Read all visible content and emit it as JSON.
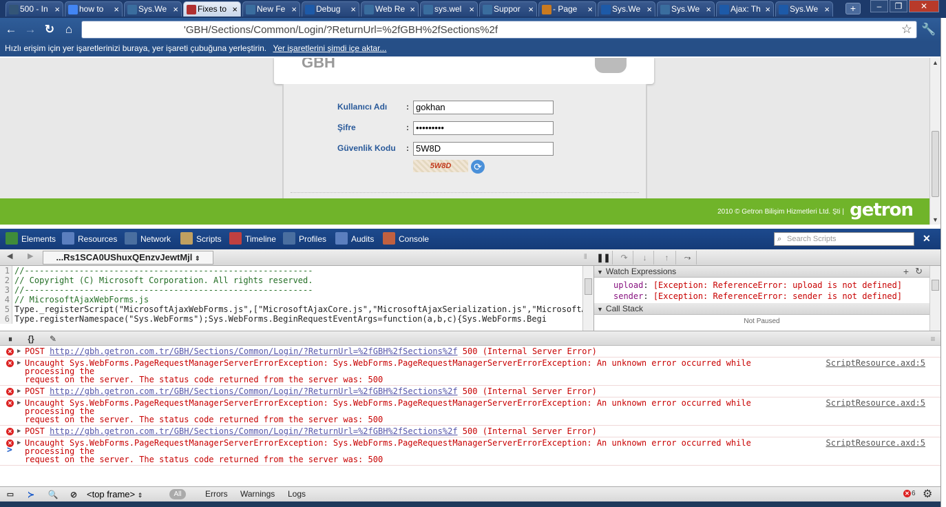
{
  "tabs": [
    {
      "title": "500 - In",
      "icon_color": "#335577",
      "icon": "chrome",
      "active": false
    },
    {
      "title": "how to",
      "icon_color": "#4285f4",
      "icon": "google",
      "active": false
    },
    {
      "title": "Sys.We",
      "icon_color": "#3a6d9e",
      "icon": "stackoverflow",
      "active": false
    },
    {
      "title": "Fixes to",
      "icon_color": "#b03030",
      "icon": "page",
      "active": true
    },
    {
      "title": "New Fe",
      "icon_color": "#3a6d9e",
      "icon": "stackoverflow",
      "active": false
    },
    {
      "title": "Debug",
      "icon_color": "#1d5aa8",
      "icon": "asp-net",
      "active": false
    },
    {
      "title": "Web Re",
      "icon_color": "#3a6d9e",
      "icon": "stackoverflow",
      "active": false
    },
    {
      "title": "sys.wel",
      "icon_color": "#3a6d9e",
      "icon": "stackoverflow",
      "active": false
    },
    {
      "title": "Suppor",
      "icon_color": "#3a6d9e",
      "icon": "stackoverflow",
      "active": false
    },
    {
      "title": "- Page",
      "icon_color": "#c97a20",
      "icon": "tools",
      "active": false
    },
    {
      "title": "Sys.We",
      "icon_color": "#1d5aa8",
      "icon": "asp-net",
      "active": false
    },
    {
      "title": "Sys.We",
      "icon_color": "#3a6d9e",
      "icon": "stackoverflow",
      "active": false
    },
    {
      "title": "Ajax: Th",
      "icon_color": "#1d5aa8",
      "icon": "asp-net",
      "active": false
    },
    {
      "title": "Sys.We",
      "icon_color": "#1d5aa8",
      "icon": "asp-net",
      "active": false
    }
  ],
  "address": {
    "url": "'GBH/Sections/Common/Login/?ReturnUrl=%2fGBH%2fSections%2f"
  },
  "bookmarks": {
    "hint": "Hızlı erişim için yer işaretlerinizi buraya, yer işareti çubuğuna yerleştirin.",
    "import_link": "Yer işaretlerini şimdi içe aktar..."
  },
  "page": {
    "logo_text": "GBH",
    "username_label": "Kullanıcı Adı",
    "username_value": "gokhan",
    "password_label": "Şifre",
    "password_value": "•••••••••",
    "captcha_label": "Güvenlik Kodu",
    "captcha_value": "5W8D",
    "captcha_image_text": "5W8D",
    "colon": ":",
    "footer_copyright": "2010 © Getron Bilişim Hizmetleri Ltd. Şti |",
    "footer_brand": "getron"
  },
  "devtools": {
    "panels": [
      {
        "label": "Elements",
        "color": "#3f8c3a"
      },
      {
        "label": "Resources",
        "color": "#5b7fbf"
      },
      {
        "label": "Network",
        "color": "#4a6fa0"
      },
      {
        "label": "Scripts",
        "color": "#c0a060"
      },
      {
        "label": "Timeline",
        "color": "#c04040"
      },
      {
        "label": "Profiles",
        "color": "#4a6fa0"
      },
      {
        "label": "Audits",
        "color": "#5b7fbf"
      },
      {
        "label": "Console",
        "color": "#c06040"
      }
    ],
    "search_placeholder": "Search Scripts",
    "script_select": "...Rs1SCA0UShuxQEnzvJewtMjl",
    "code_lines": [
      {
        "n": "1",
        "text": "//----------------------------------------------------------",
        "kind": "comment"
      },
      {
        "n": "2",
        "text": "// Copyright (C) Microsoft Corporation. All rights reserved.",
        "kind": "comment"
      },
      {
        "n": "3",
        "text": "//----------------------------------------------------------",
        "kind": "comment"
      },
      {
        "n": "4",
        "text": "// MicrosoftAjaxWebForms.js",
        "kind": "comment"
      },
      {
        "n": "5",
        "text": "Type._registerScript(\"MicrosoftAjaxWebForms.js\",[\"MicrosoftAjaxCore.js\",\"MicrosoftAjaxSerialization.js\",\"MicrosoftAjax",
        "kind": "code"
      },
      {
        "n": "6",
        "text": "Type.registerNamespace(\"Sys.WebForms\");Sys.WebForms.BeginRequestEventArgs=function(a,b,c){Sys.WebForms.Begi",
        "kind": "code"
      }
    ],
    "watch_title": "Watch Expressions",
    "watch": [
      {
        "name": "upload",
        "value": "[Exception: ReferenceError: upload is not defined]"
      },
      {
        "name": "sender",
        "value": "[Exception: ReferenceError: sender is not defined]"
      }
    ],
    "callstack_title": "Call Stack",
    "not_paused": "Not Paused",
    "console": [
      {
        "kind": "post",
        "method": "POST",
        "url": "http://gbh.getron.com.tr/GBH/Sections/Common/Login/?ReturnUrl=%2fGBH%2fSections%2f",
        "status": "500 (Internal Server Error)"
      },
      {
        "kind": "error",
        "line1": "Uncaught Sys.WebForms.PageRequestManagerServerErrorException: Sys.WebForms.PageRequestManagerServerErrorException: An unknown error occurred while processing the",
        "line2": "request on the server. The status code returned from the server was: 500",
        "source": "ScriptResource.axd:5"
      },
      {
        "kind": "post",
        "method": "POST",
        "url": "http://gbh.getron.com.tr/GBH/Sections/Common/Login/?ReturnUrl=%2fGBH%2fSections%2f",
        "status": "500 (Internal Server Error)"
      },
      {
        "kind": "error",
        "line1": "Uncaught Sys.WebForms.PageRequestManagerServerErrorException: Sys.WebForms.PageRequestManagerServerErrorException: An unknown error occurred while processing the",
        "line2": "request on the server. The status code returned from the server was: 500",
        "source": "ScriptResource.axd:5"
      },
      {
        "kind": "post",
        "method": "POST",
        "url": "http://gbh.getron.com.tr/GBH/Sections/Common/Login/?ReturnUrl=%2fGBH%2fSections%2f",
        "status": "500 (Internal Server Error)"
      },
      {
        "kind": "error",
        "line1": "Uncaught Sys.WebForms.PageRequestManagerServerErrorException: Sys.WebForms.PageRequestManagerServerErrorException: An unknown error occurred while processing the",
        "line2": "request on the server. The status code returned from the server was: 500",
        "source": "ScriptResource.axd:5"
      }
    ],
    "prompt_symbol": ">",
    "status": {
      "frame": "<top frame>",
      "all": "All",
      "errors": "Errors",
      "warnings": "Warnings",
      "logs": "Logs",
      "error_count": "6"
    }
  }
}
